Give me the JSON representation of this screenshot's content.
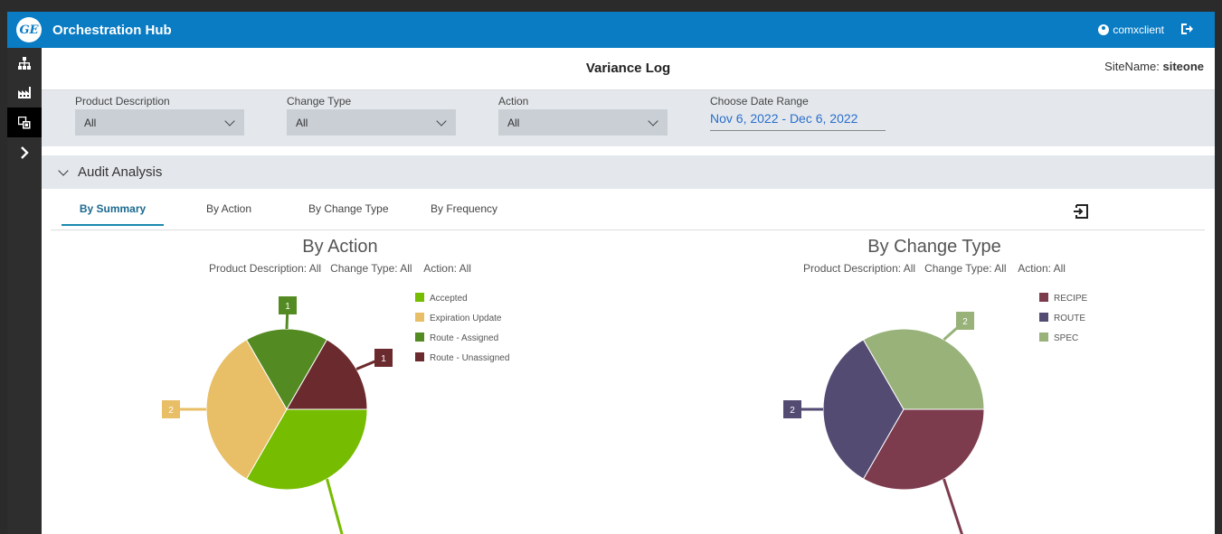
{
  "app": {
    "logo_text": "GE",
    "title": "Orchestration Hub",
    "username": "comxclient"
  },
  "icons": {
    "logo": "ge-logo",
    "user": "user-circle-icon",
    "logout": "logout-icon",
    "sidebar": [
      "hierarchy-icon",
      "factory-icon",
      "copy-icon",
      "chevron-right-icon"
    ],
    "export": "export-icon"
  },
  "page": {
    "title": "Variance Log",
    "site_label": "SiteName:",
    "site_value": "siteone"
  },
  "filters": {
    "product": {
      "label": "Product Description",
      "value": "All"
    },
    "change_type": {
      "label": "Change Type",
      "value": "All"
    },
    "action": {
      "label": "Action",
      "value": "All"
    },
    "date": {
      "label": "Choose Date Range",
      "value": "Nov 6, 2022 - Dec 6, 2022"
    }
  },
  "section": {
    "title": "Audit Analysis"
  },
  "tabs": [
    "By Summary",
    "By Action",
    "By Change Type",
    "By Frequency"
  ],
  "active_tab": "By Summary",
  "colors": {
    "topbar": "#0a7cc4",
    "accepted": "#76bc00",
    "expiration": "#e8bf66",
    "route_assigned": "#548a22",
    "route_unassigned": "#6b2a2d",
    "recipe": "#7d3b4e",
    "route": "#544b73",
    "spec": "#98b27a"
  },
  "chart_data": [
    {
      "type": "pie",
      "title": "By Action",
      "subtitle": "Product Description: All   Change Type: All    Action: All",
      "legend_position": "right",
      "slices": [
        {
          "label": "Accepted",
          "value": 2,
          "color": "#76bc00"
        },
        {
          "label": "Expiration Update",
          "value": 2,
          "color": "#e8bf66"
        },
        {
          "label": "Route - Assigned",
          "value": 1,
          "color": "#548a22"
        },
        {
          "label": "Route - Unassigned",
          "value": 1,
          "color": "#6b2a2d"
        }
      ]
    },
    {
      "type": "pie",
      "title": "By Change Type",
      "subtitle": "Product Description: All   Change Type: All    Action: All",
      "legend_position": "right",
      "slices": [
        {
          "label": "RECIPE",
          "value": 2,
          "color": "#7d3b4e"
        },
        {
          "label": "ROUTE",
          "value": 2,
          "color": "#544b73"
        },
        {
          "label": "SPEC",
          "value": 2,
          "color": "#98b27a"
        }
      ]
    }
  ]
}
